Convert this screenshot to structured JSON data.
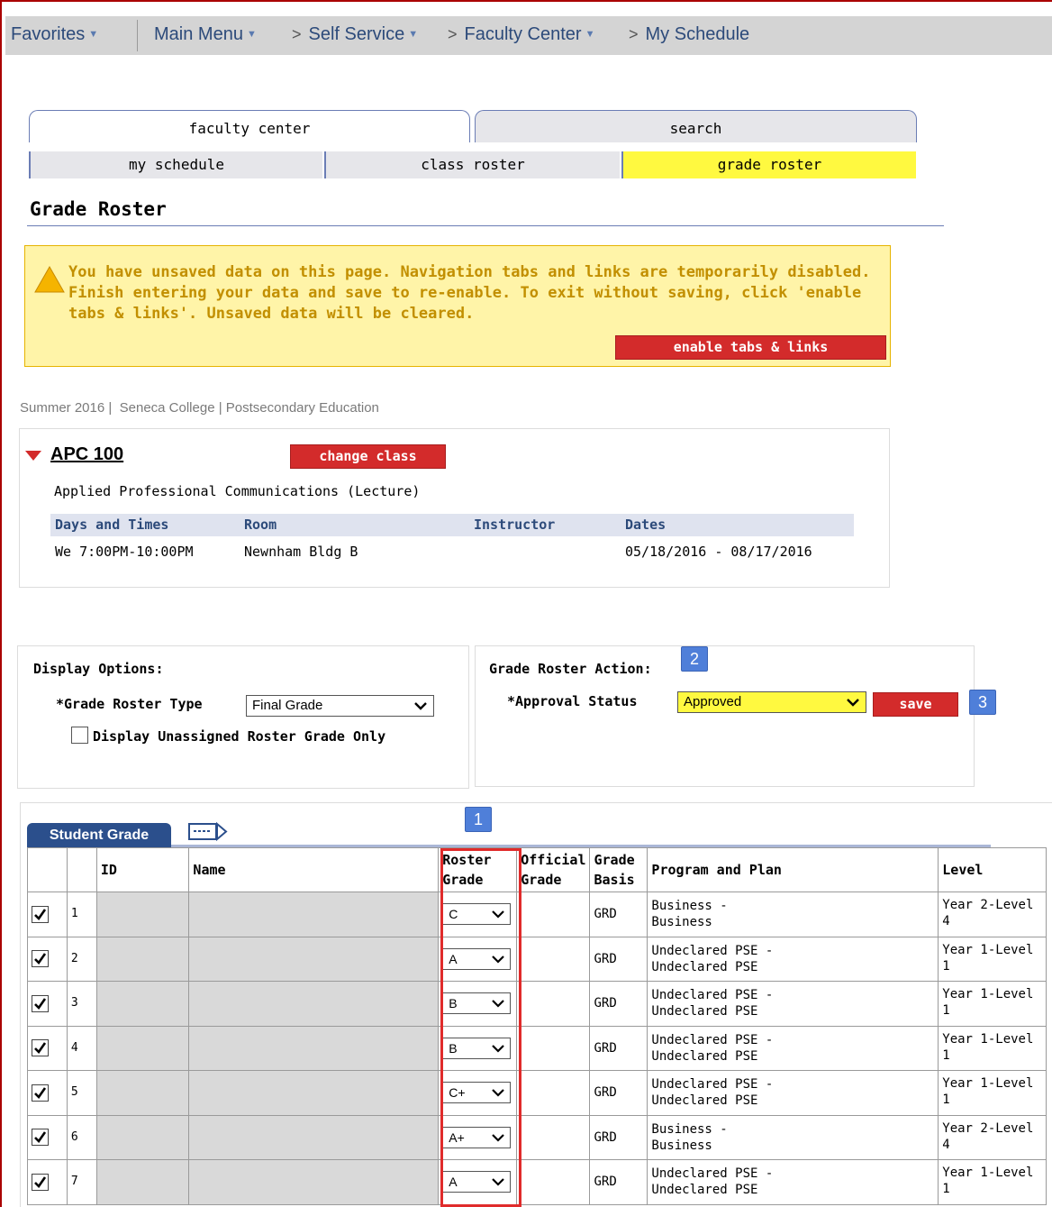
{
  "nav": {
    "favorites": "Favorites",
    "main_menu": "Main Menu",
    "self_service": "Self Service",
    "faculty_center": "Faculty Center",
    "my_schedule": "My Schedule"
  },
  "tabs": {
    "top": [
      "faculty center",
      "search"
    ],
    "sub": [
      "my schedule",
      "class roster",
      "grade roster"
    ],
    "active_sub": "grade roster"
  },
  "page_title": "Grade Roster",
  "warning": {
    "message": "You have unsaved data on this page. Navigation tabs and links are temporarily disabled. Finish entering your data and save to re-enable. To exit without saving, click 'enable tabs & links'. Unsaved data will be cleared.",
    "button": "enable tabs & links"
  },
  "context": {
    "term": "Summer 2016",
    "institution": "Seneca College",
    "career": "Postsecondary Education"
  },
  "class": {
    "code": "APC 100",
    "change_button": "change class",
    "description": "Applied Professional Communications (Lecture)",
    "headers": [
      "Days and Times",
      "Room",
      "Instructor",
      "Dates"
    ],
    "meeting": {
      "days_times": "We 7:00PM-10:00PM",
      "room": "Newnham Bldg B",
      "instructor": "",
      "dates": "05/18/2016 - 08/17/2016"
    }
  },
  "display_options": {
    "title": "Display Options:",
    "roster_type_label": "*Grade Roster Type",
    "roster_type_value": "Final Grade",
    "unassigned_label": "Display Unassigned Roster Grade Only"
  },
  "roster_action": {
    "title": "Grade Roster Action:",
    "approval_label": "*Approval Status",
    "approval_value": "Approved",
    "save_button": "save"
  },
  "badges": [
    "1",
    "2",
    "3"
  ],
  "grid": {
    "tab": "Student Grade",
    "headers": {
      "id": "ID",
      "name": "Name",
      "roster_grade_1": "Roster",
      "roster_grade_2": "Grade",
      "official_grade_1": "Official",
      "official_grade_2": "Grade",
      "grade_basis_1": "Grade",
      "grade_basis_2": "Basis",
      "program": "Program and Plan",
      "level": "Level"
    },
    "rows": [
      {
        "num": "1",
        "grade": "C",
        "basis": "GRD",
        "program": [
          "Business -",
          "Business"
        ],
        "level": [
          "Year 2-Level",
          "4"
        ]
      },
      {
        "num": "2",
        "grade": "A",
        "basis": "GRD",
        "program": [
          "Undeclared PSE -",
          "Undeclared PSE"
        ],
        "level": [
          "Year 1-Level",
          "1"
        ]
      },
      {
        "num": "3",
        "grade": "B",
        "basis": "GRD",
        "program": [
          "Undeclared PSE -",
          "Undeclared PSE"
        ],
        "level": [
          "Year 1-Level",
          "1"
        ]
      },
      {
        "num": "4",
        "grade": "B",
        "basis": "GRD",
        "program": [
          "Undeclared PSE -",
          "Undeclared PSE"
        ],
        "level": [
          "Year 1-Level",
          "1"
        ]
      },
      {
        "num": "5",
        "grade": "C+",
        "basis": "GRD",
        "program": [
          "Undeclared PSE -",
          "Undeclared PSE"
        ],
        "level": [
          "Year 1-Level",
          "1"
        ]
      },
      {
        "num": "6",
        "grade": "A+",
        "basis": "GRD",
        "program": [
          "Business -",
          "Business"
        ],
        "level": [
          "Year 2-Level",
          "4"
        ]
      },
      {
        "num": "7",
        "grade": "A",
        "basis": "GRD",
        "program": [
          "Undeclared PSE -",
          "Undeclared PSE"
        ],
        "level": [
          "Year 1-Level",
          "1"
        ]
      }
    ]
  }
}
